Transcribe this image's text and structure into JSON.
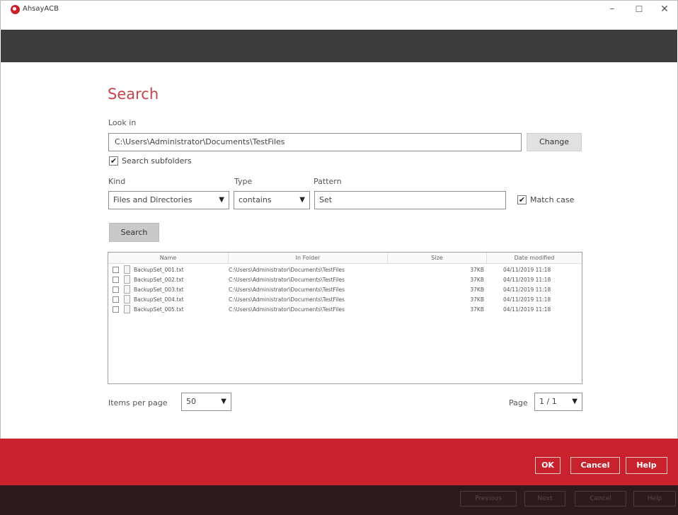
{
  "window": {
    "app_title": "AhsayACB",
    "minimize": "–",
    "maximize": "☐",
    "close": "✕"
  },
  "search": {
    "title": "Search",
    "look_in_label": "Look in",
    "look_in_value": "C:\\Users\\Administrator\\Documents\\TestFiles",
    "change_label": "Change",
    "search_subfolders_label": "Search subfolders",
    "search_subfolders_checked": true,
    "kind_label": "Kind",
    "kind_value": "Files and Directories",
    "type_label": "Type",
    "type_value": "contains",
    "pattern_label": "Pattern",
    "pattern_value": "Set",
    "match_case_label": "Match case",
    "match_case_checked": true,
    "search_button": "Search"
  },
  "results": {
    "columns": [
      "Name",
      "In Folder",
      "Size",
      "Date modified"
    ],
    "rows": [
      {
        "name": "BackupSet_001.txt",
        "folder": "C:\\Users\\Administrator\\Documents\\TestFiles",
        "size": "37KB",
        "date": "04/11/2019 11:18"
      },
      {
        "name": "BackupSet_002.txt",
        "folder": "C:\\Users\\Administrator\\Documents\\TestFiles",
        "size": "37KB",
        "date": "04/11/2019 11:18"
      },
      {
        "name": "BackupSet_003.txt",
        "folder": "C:\\Users\\Administrator\\Documents\\TestFiles",
        "size": "37KB",
        "date": "04/11/2019 11:18"
      },
      {
        "name": "BackupSet_004.txt",
        "folder": "C:\\Users\\Administrator\\Documents\\TestFiles",
        "size": "37KB",
        "date": "04/11/2019 11:18"
      },
      {
        "name": "BackupSet_005.txt",
        "folder": "C:\\Users\\Administrator\\Documents\\TestFiles",
        "size": "37KB",
        "date": "04/11/2019 11:18"
      }
    ]
  },
  "pagination": {
    "items_per_page_label": "Items per page",
    "items_per_page_value": "50",
    "page_label": "Page",
    "page_value": "1 / 1"
  },
  "footer": {
    "ok": "OK",
    "cancel": "Cancel",
    "help": "Help"
  },
  "background_footer": {
    "previous": "Previous",
    "next": "Next",
    "cancel": "Cancel",
    "help": "Help"
  },
  "colors": {
    "accent_red": "#c8232c",
    "title_red": "#c8434b",
    "dark_bar": "#3d3d3d"
  }
}
